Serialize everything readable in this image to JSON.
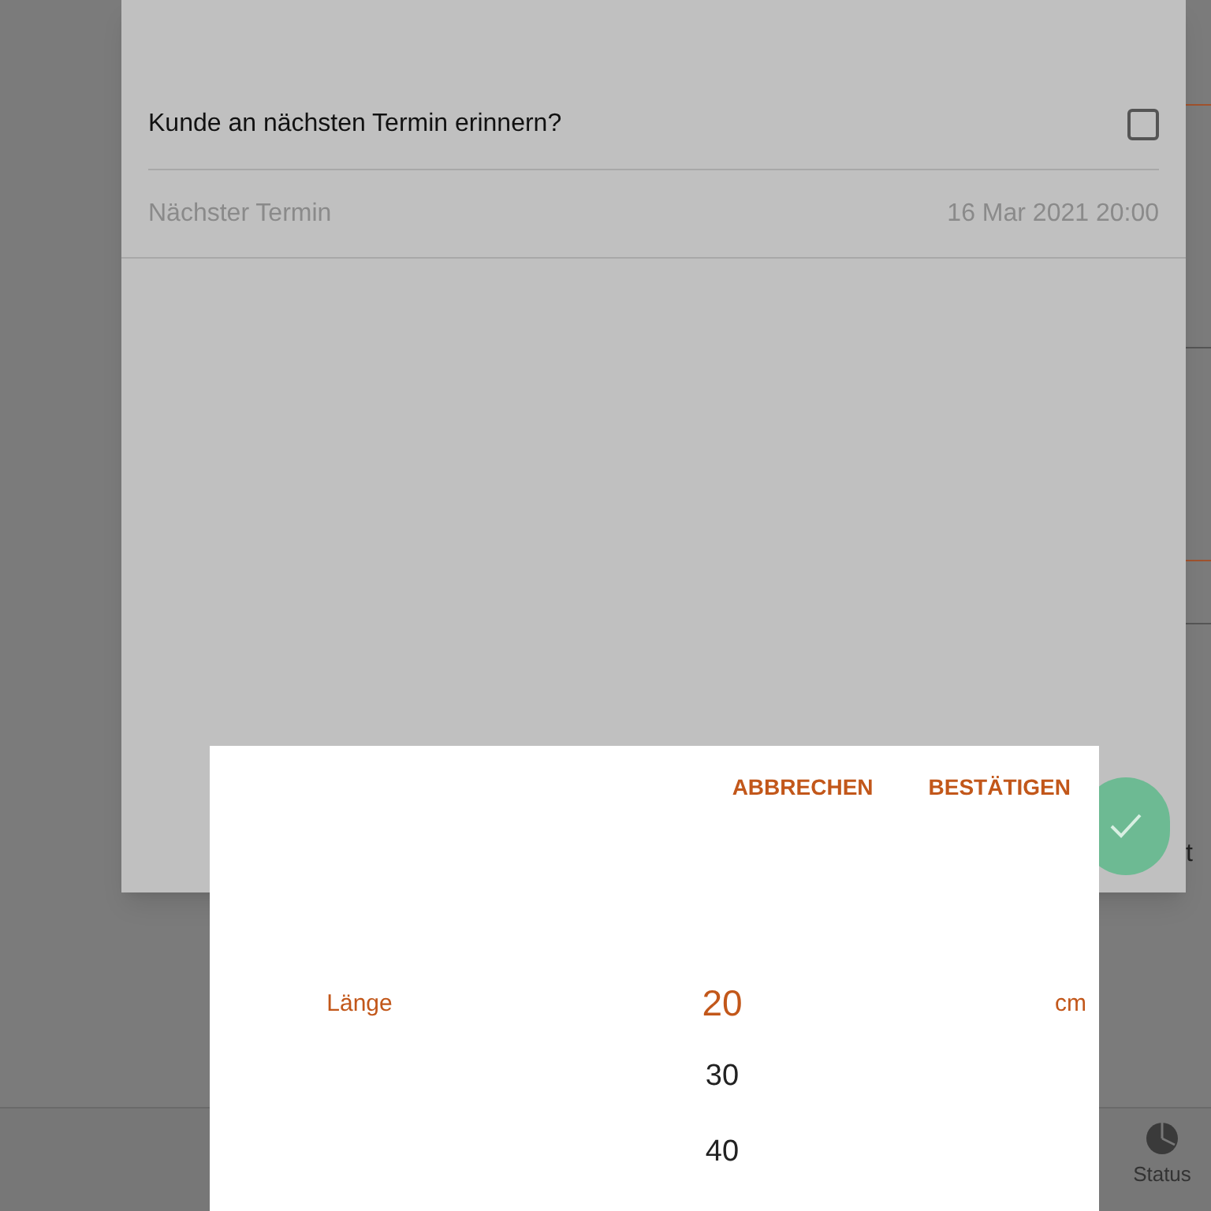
{
  "background": {
    "fragment": "t",
    "bottom_nav": {
      "label": "Status"
    }
  },
  "dialog": {
    "reminder": {
      "label": "Kunde an nächsten Termin erinnern?",
      "checked": false
    },
    "next_appointment": {
      "label": "Nächster Termin",
      "value": "16 Mar 2021 20:00"
    }
  },
  "picker": {
    "buttons": [
      "ABBRECHEN",
      "BESTÄTIGEN"
    ],
    "label": "Länge",
    "unit": "cm",
    "options": [
      {
        "label": "20",
        "selected": true
      },
      {
        "label": "30",
        "selected": false
      },
      {
        "label": "40",
        "selected": false
      }
    ]
  }
}
